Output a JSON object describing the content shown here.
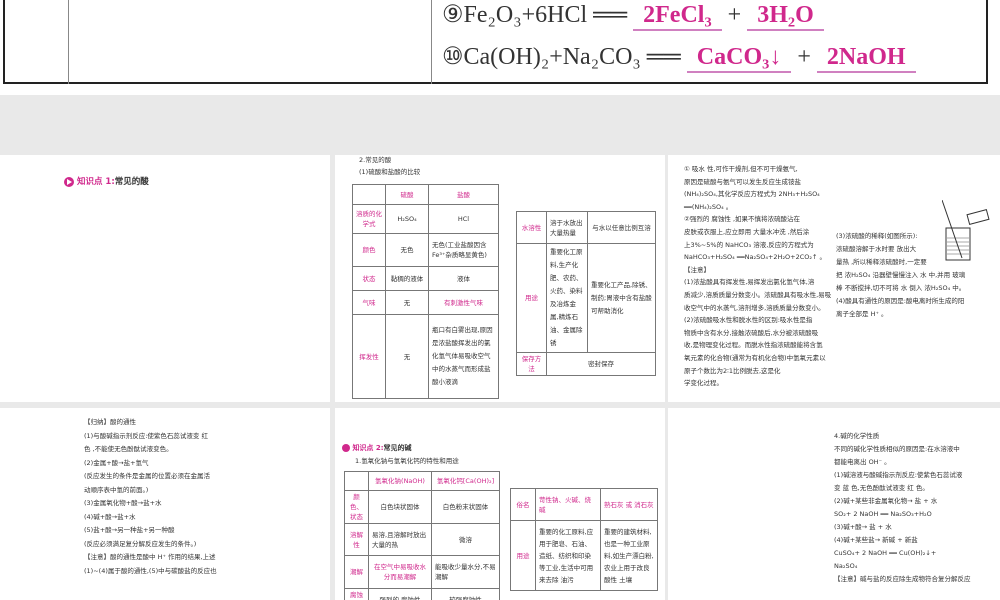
{
  "top_slide": {
    "eq9": {
      "prefix": "⑨Fe₂O₃+6HCl ══",
      "a1": "2FeCl₃",
      "plus": "+",
      "a2": "3H₂O"
    },
    "eq10": {
      "prefix": "⑩Ca(OH)₂+Na₂CO₃ ══",
      "a1": "CaCO₃↓",
      "plus": "+",
      "a2": "2NaOH"
    }
  },
  "slide1": {
    "title_prefix": "知识点 1:",
    "title": "常见的酸"
  },
  "slide2": {
    "heading": "2.常见的酸",
    "subheading": "(1)硫酸和盐酸的比较",
    "table1": {
      "headers": [
        "",
        "硫酸",
        "盐酸"
      ],
      "rows": [
        [
          "溶质的化学式",
          "H₂SO₄",
          "HCl"
        ],
        [
          "颜色",
          "无色",
          "无色(工业盐酸因含Fe³⁺杂质略显黄色)"
        ],
        [
          "状态",
          "黏稠的液体",
          "液体"
        ],
        [
          "气味",
          "无",
          "有刺激性气味"
        ],
        [
          "挥发性",
          "无",
          "瓶口有白雾出现,原因是浓盐酸挥发出的氯化氢气体易吸收空气中的水蒸气而形成盐酸小液滴"
        ]
      ]
    },
    "table2": {
      "rows": [
        [
          "水溶性",
          "溶于水放出大量热量",
          "与水以任意比例互溶"
        ],
        [
          "用途",
          "重要化工原料,生产化肥、农药、火药、染料及冶炼金属,精炼石油、金属除锈",
          "重要化工产品,除锈、制药;胃液中含有盐酸可帮助消化"
        ],
        [
          "保存方法",
          "密封保存"
        ]
      ]
    }
  },
  "slide3": {
    "title": "(2)浓硫酸的特性",
    "lines": [
      "① 吸水 性,可作干燥剂,但不可干燥氨气,",
      "原因是硫酸与氨气可以发生反应生成铵盐",
      "(NH₄)₂SO₄,其化学反应方程式为 2NH₃+H₂SO₄",
      "══(NH₄)₂SO₄ 。",
      "②强烈的 腐蚀性 ,如果不慎将浓硫酸沾在",
      "皮肤或衣服上,应立即用 大量水冲洗 ,然后涂",
      "上3%~5%的 NaHCO₃ 溶液,反应的方程式为",
      "NaHCO₃+H₂SO₄ ══Na₂SO₄+2H₂O+2CO₂↑ 。",
      "【注意】",
      "(1)浓盐酸具有挥发性,易挥发出氯化氢气体,溶",
      "质减少,溶质质量分数变小。浓硫酸具有吸水性,易吸",
      "收空气中的水蒸气,溶剂增多,溶质质量分数变小。",
      "(2)浓硫酸吸水性和脱水性的区别:吸水性是指",
      "物质中含有水分,接触浓硫酸后,水分被浓硫酸吸",
      "收,是物理变化过程。而脱水性指浓硫酸能将含氢",
      "氧元素的化合物(通常为有机化合物)中氢氧元素以",
      "原子个数比为2∶1比例脱去,这是化",
      "学变化过程。"
    ],
    "right_lines": [
      "(3)浓硫酸的稀释(如图所示):",
      "浓硫酸溶解于水时要 放出大",
      "量热 ,所以稀释浓硫酸时,一定要",
      "把 浓H₂SO₄ 沿器壁慢慢注入 水 中,并用 玻璃",
      "棒 不断搅拌,切不可将 水 倒入 浓H₂SO₄ 中。",
      "(4)酸具有通性的原因是:酸电离时所生成的阳",
      "离子全部是 H⁺ 。"
    ]
  },
  "slide4": {
    "lines": [
      "【归纳】酸的通性",
      "(1)与酸碱指示剂反应:使紫色石蕊试液变 红",
      "色 ,不能使无色酚酞试液变色。",
      "(2)金属+酸→盐+氢气",
      "(反应发生的条件是金属的位置必须在金属活",
      "动顺序表中氢的前面。)",
      "(3)金属氧化物+酸→盐+水",
      "(4)碱+酸→盐+水",
      "(5)盐+酸→另一种盐+另一种酸",
      "(反应必须满足复分解反应发生的条件。)",
      "【注意】酸的通性是酸中 H⁺ 作用的结果,上述",
      "(1)~(4)属于酸的通性,(5)中与碳酸盐的反应也"
    ]
  },
  "slide5": {
    "title_prefix": "知识点 2:",
    "title": "常见的碱",
    "subheading": "1.氢氧化钠与氢氧化钙的特性和用途",
    "table1": {
      "headers": [
        "",
        "氢氧化钠(NaOH)",
        "氢氧化钙[Ca(OH)₂]"
      ],
      "rows": [
        [
          "颜色、状态",
          "白色块状固体",
          "白色粉末状固体"
        ],
        [
          "溶解性",
          "易溶,且溶解时放出大量的热",
          "微溶"
        ],
        [
          "潮解",
          "在空气中易吸收水分而易潮解",
          "能吸收少量水分,不易潮解"
        ],
        [
          "腐蚀性",
          "强烈的 腐蚀性",
          "较强腐蚀性"
        ]
      ]
    },
    "table2": {
      "rows": [
        [
          "俗名",
          "苛性钠、火碱、烧碱",
          "熟石灰 或 消石灰"
        ],
        [
          "用途",
          "重要的化工原料,应用于肥皂、石油、造纸、纺织和印染等工业,生活中可用来去除 油污",
          "重要的建筑材料,也是一种工业原料,如生产漂白粉,农业上用于改良 酸性 土壤"
        ]
      ]
    }
  },
  "slide6": {
    "lines": [
      "4.碱的化学性质",
      "不同的碱化学性质相似的原因是:在水溶液中",
      "都能电离出 OH⁻ 。",
      "(1)碱溶液与酸碱指示剂反应:使紫色石蕊试液",
      "变 蓝 色,无色酚酞试液变 红 色。",
      "(2)碱+某些非金属氧化物→ 盐 + 水",
      "SO₂+ 2 NaOH ══ Na₂SO₃+H₂O",
      "(3)碱+酸→ 盐 + 水",
      "(4)碱+某些盐→ 新碱 + 新盐",
      "CuSO₄+ 2 NaOH ══ Cu(OH)₂↓+",
      "Na₂SO₄",
      "【注意】碱与盐的反应除生成物符合复分解反应"
    ]
  },
  "colors": {
    "accent": "#d0288c",
    "background": "#e9e9e9"
  }
}
